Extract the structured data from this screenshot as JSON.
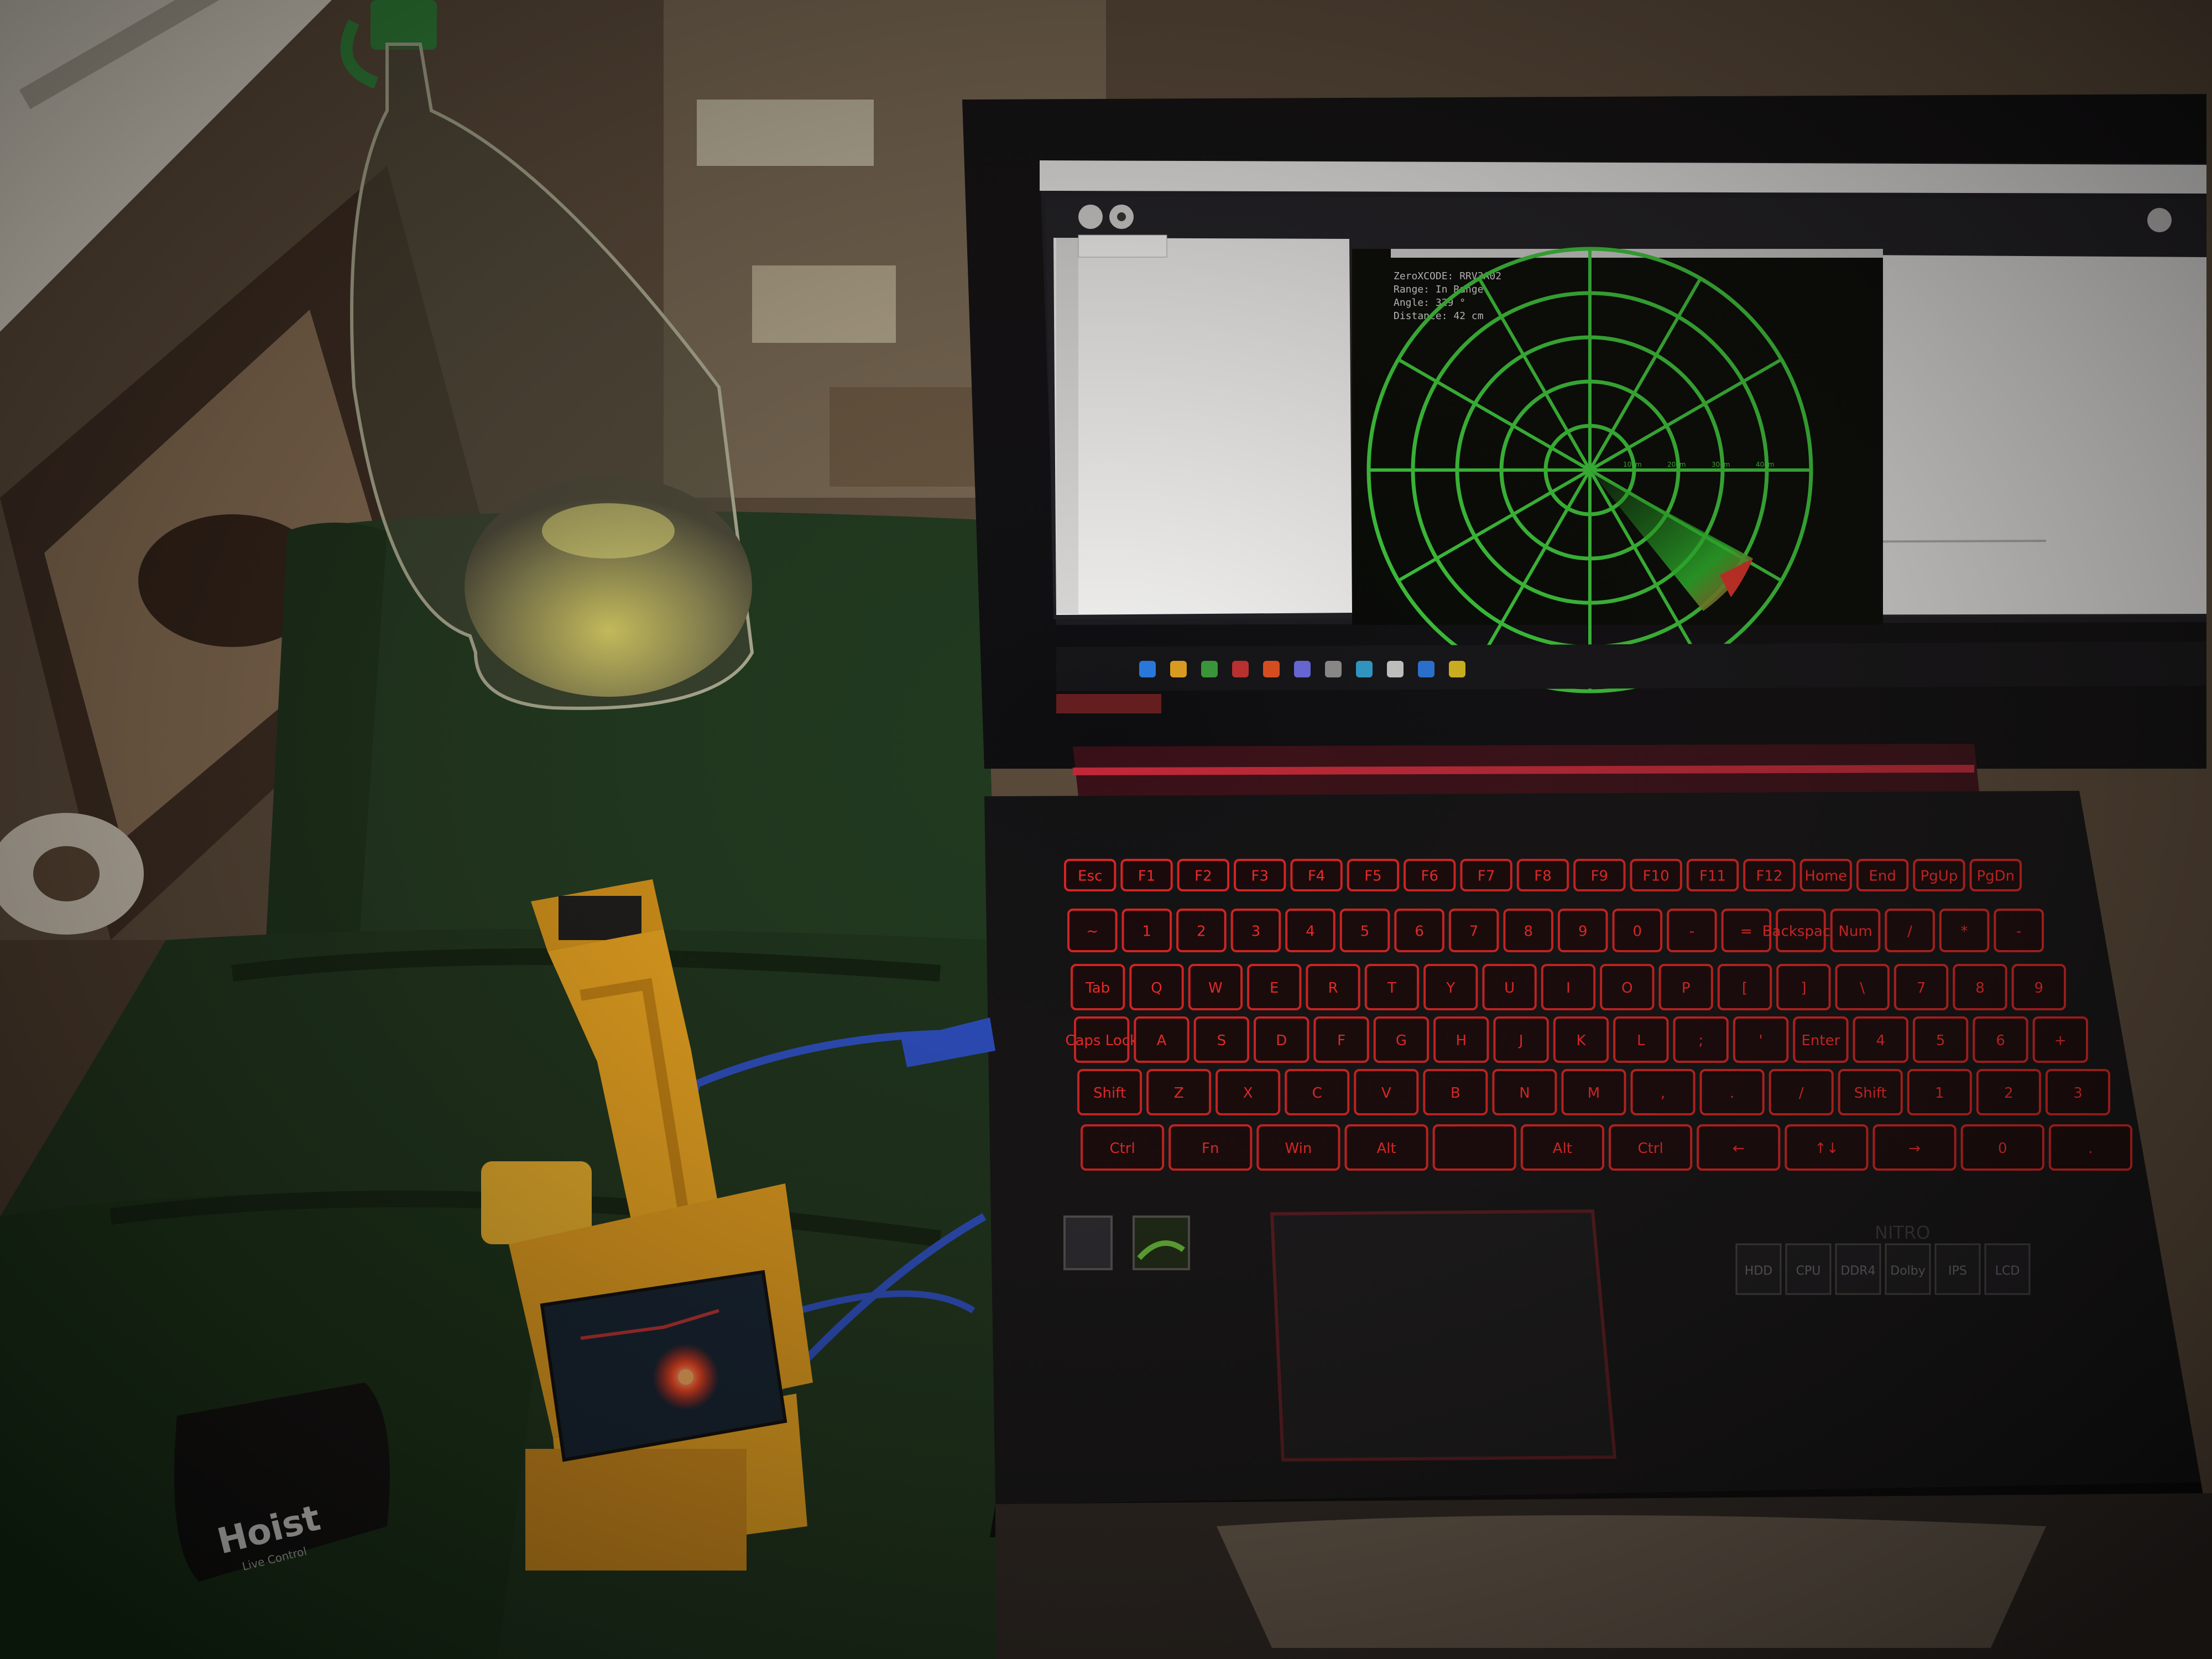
{
  "scene": {
    "description_tags": [
      "laptop",
      "radar-display",
      "arduino-robot",
      "bottle",
      "carpet",
      "cushion"
    ]
  },
  "radar_window": {
    "lines": [
      {
        "label": "ZeroXCODE:",
        "value": "RRV3A02"
      },
      {
        "label": "Range:",
        "value": "In Range"
      },
      {
        "label": "Angle:",
        "value": "329 °"
      },
      {
        "label": "Distance:",
        "value": "42 cm"
      }
    ],
    "range_tick_labels": [
      "10cm",
      "20cm",
      "30cm",
      "40cm"
    ]
  },
  "laptop": {
    "brand_badge": "NITRO",
    "keyboard_rows": [
      [
        "Esc",
        "F1",
        "F2",
        "F3",
        "F4",
        "F5",
        "F6",
        "F7",
        "F8",
        "F9",
        "F10",
        "F11",
        "F12",
        "Home",
        "End",
        "PgUp",
        "PgDn"
      ],
      [
        "~",
        "1",
        "2",
        "3",
        "4",
        "5",
        "6",
        "7",
        "8",
        "9",
        "0",
        "-",
        "=",
        "Backspace",
        "Num",
        "/",
        "*",
        "-"
      ],
      [
        "Tab",
        "Q",
        "W",
        "E",
        "R",
        "T",
        "Y",
        "U",
        "I",
        "O",
        "P",
        "[",
        "]",
        "\\",
        "7",
        "8",
        "9"
      ],
      [
        "Caps Lock",
        "A",
        "S",
        "D",
        "F",
        "G",
        "H",
        "J",
        "K",
        "L",
        ";",
        "'",
        "Enter",
        "4",
        "5",
        "6",
        "+"
      ],
      [
        "Shift",
        "Z",
        "X",
        "C",
        "V",
        "B",
        "N",
        "M",
        ",",
        ".",
        "/",
        "Shift",
        "1",
        "2",
        "3"
      ],
      [
        "Ctrl",
        "Fn",
        "Win",
        "Alt",
        "",
        "Alt",
        "Ctrl",
        "←",
        "↑↓",
        "→",
        "0",
        "."
      ]
    ],
    "feature_stickers": [
      "HDD",
      "CPU",
      "DDR4",
      "Dolby",
      "IPS",
      "LCD"
    ]
  },
  "bottle": {
    "label": ""
  },
  "charger": {
    "brand": "Hoist",
    "subtitle": "Live Control"
  },
  "colors": {
    "radar_green": "#3ccf3c",
    "sweep_red": "#e0342a",
    "keyboard_glow": "#ff2a2a",
    "cushion_green": "#1f3a1f",
    "robot_yellow": "#f0a81e",
    "usb_blue": "#2a4fc8"
  }
}
